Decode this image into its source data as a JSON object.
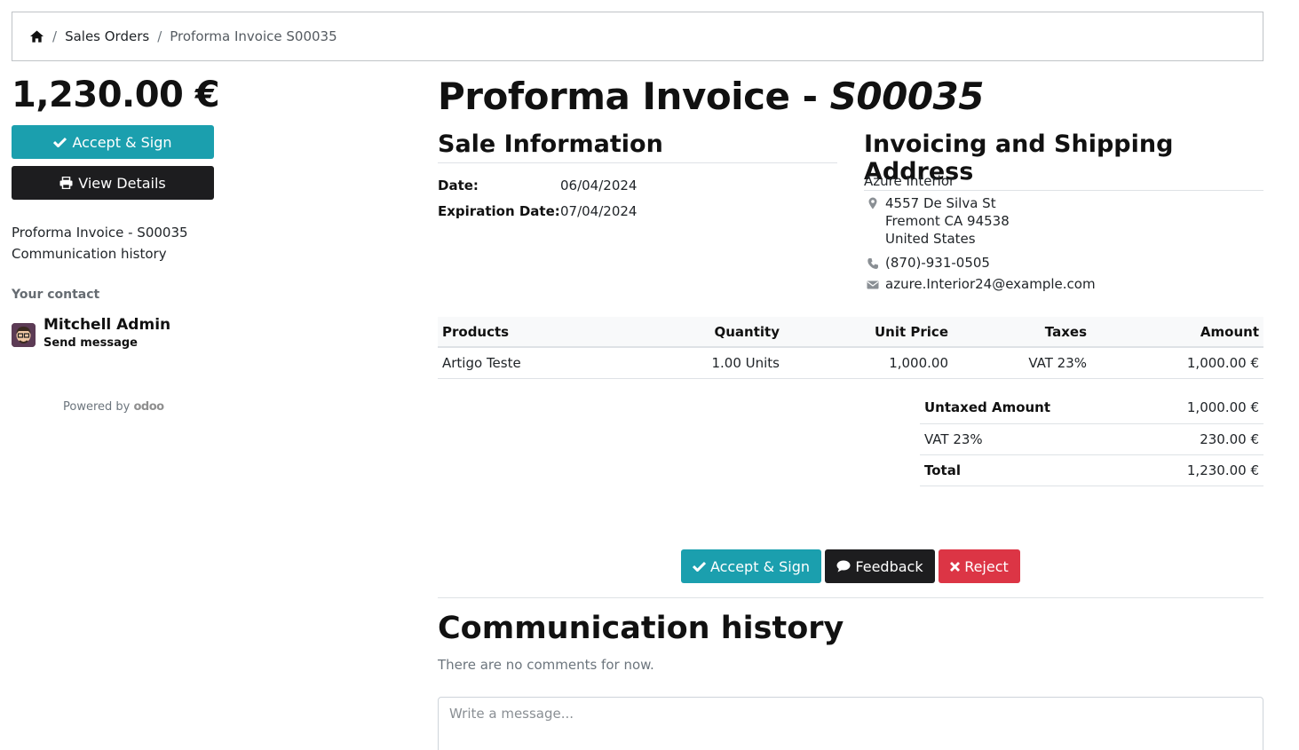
{
  "breadcrumb": {
    "home_icon": "home-icon",
    "items": [
      "Sales Orders",
      "Proforma Invoice S00035"
    ]
  },
  "sidebar": {
    "amount": "1,230.00 €",
    "accept_sign_label": "Accept & Sign",
    "view_details_label": "View Details",
    "links": [
      "Proforma Invoice - S00035",
      "Communication history"
    ],
    "your_contact_label": "Your contact",
    "contact_name": "Mitchell Admin",
    "send_message_label": "Send message",
    "powered_by": "Powered by",
    "powered_brand": "odoo"
  },
  "main": {
    "title_prefix": "Proforma Invoice - ",
    "title_ref": "S00035"
  },
  "sale_info": {
    "title": "Sale Information",
    "date_label": "Date:",
    "date_value": "06/04/2024",
    "expiration_label": "Expiration Date:",
    "expiration_value": "07/04/2024"
  },
  "address": {
    "title": "Invoicing and Shipping Address",
    "company": "Azure Interior",
    "street": "4557 De Silva St",
    "city": "Fremont CA 94538",
    "country": "United States",
    "phone": "(870)-931-0505",
    "email": "azure.Interior24@example.com"
  },
  "products_table": {
    "headers": [
      "Products",
      "Quantity",
      "Unit Price",
      "Taxes",
      "Amount"
    ],
    "rows": [
      [
        "Artigo Teste",
        "1.00 Units",
        "1,000.00",
        "VAT 23%",
        "1,000.00 €"
      ]
    ]
  },
  "totals": {
    "untaxed_label": "Untaxed Amount",
    "untaxed_value": "1,000.00 €",
    "vat_label": "VAT 23%",
    "vat_value": "230.00 €",
    "total_label": "Total",
    "total_value": "1,230.00 €"
  },
  "actions": {
    "accept_sign_label": "Accept & Sign",
    "feedback_label": "Feedback",
    "reject_label": "Reject"
  },
  "communication": {
    "title": "Communication history",
    "empty_text": "There are no comments for now.",
    "placeholder": "Write a message..."
  },
  "colors": {
    "primary": "#1b9fae",
    "dark": "#1d1d1f",
    "danger": "#dc3545"
  }
}
